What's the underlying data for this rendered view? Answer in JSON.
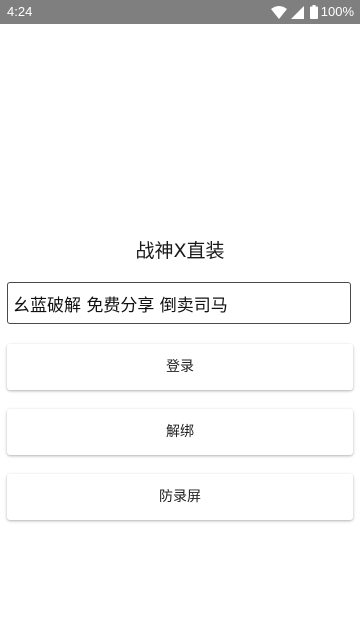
{
  "status_bar": {
    "time": "4:24",
    "battery_percent": "100%",
    "icons": [
      "wifi-icon",
      "signal-icon",
      "battery-icon"
    ],
    "background_color": "#7f7f7f"
  },
  "app": {
    "title": "战神X直装"
  },
  "input": {
    "value": "幺蓝破解 免费分享 倒卖司马"
  },
  "buttons": {
    "login": "登录",
    "unbind": "解绑",
    "anti_record": "防录屏"
  }
}
